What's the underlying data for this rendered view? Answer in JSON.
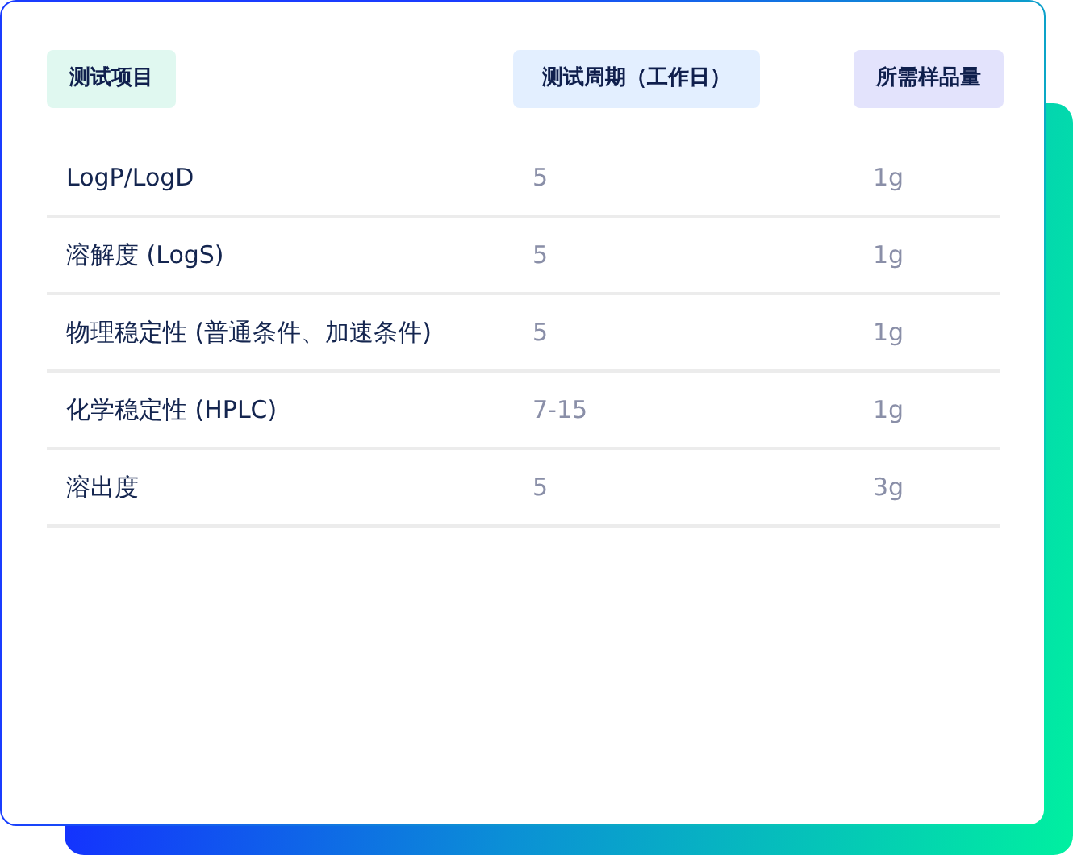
{
  "table": {
    "columns": [
      "测试项目",
      "测试周期（工作日）",
      "所需样品量"
    ],
    "rows": [
      [
        "LogP/LogD",
        "5",
        "1g"
      ],
      [
        "溶解度 (LogS)",
        "5",
        "1g"
      ],
      [
        "物理稳定性 (普通条件、加速条件)",
        "5",
        "1g"
      ],
      [
        "化学稳定性 (HPLC)",
        "7-15",
        "1g"
      ],
      [
        "溶出度",
        "5",
        "3g"
      ]
    ]
  }
}
